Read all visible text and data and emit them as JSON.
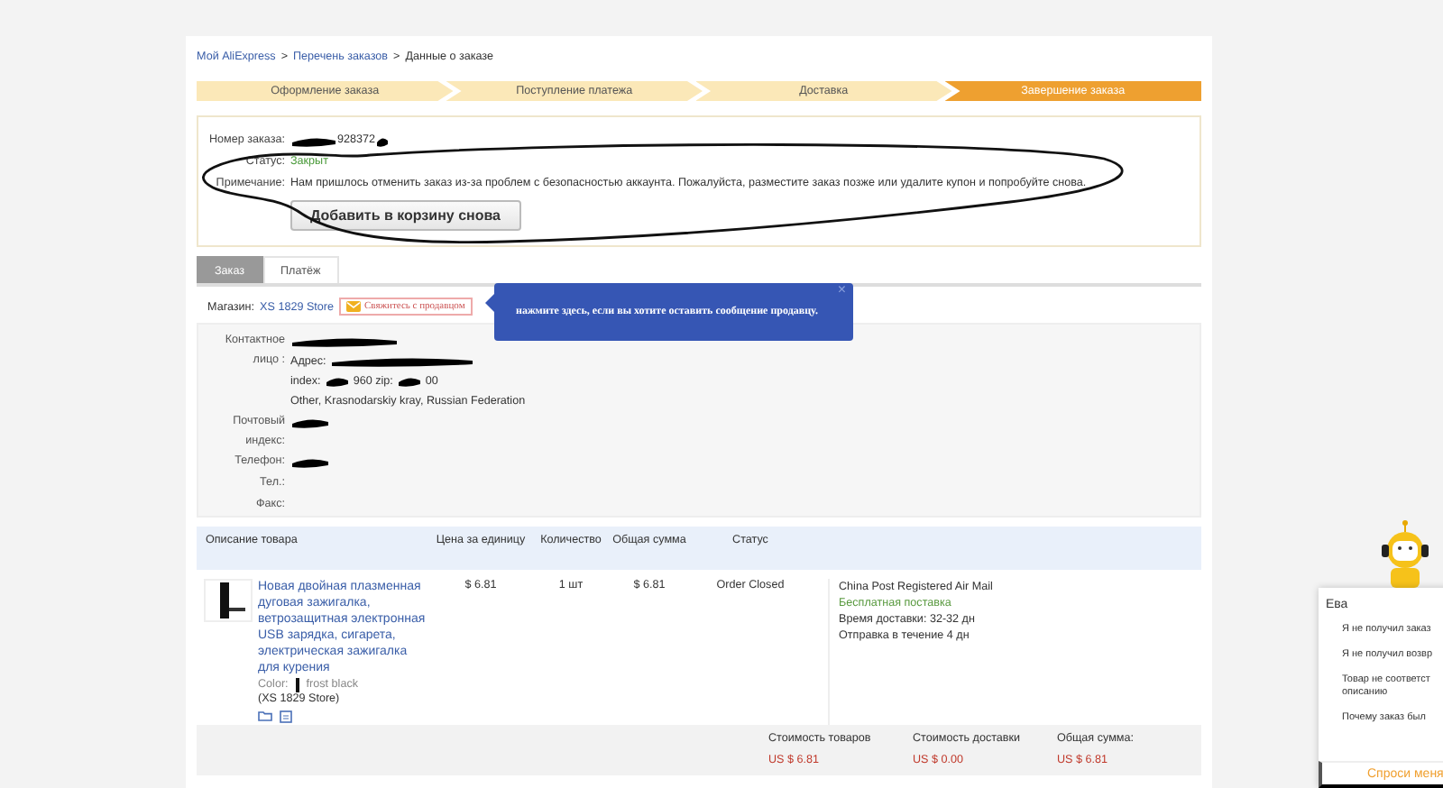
{
  "breadcrumb": [
    {
      "label": "Мой AliExpress",
      "kind": "link"
    },
    {
      "label": ">",
      "kind": "separator"
    },
    {
      "label": "Перечень заказов",
      "kind": "link"
    },
    {
      "label": ">",
      "kind": "separator"
    },
    {
      "label": "Данные о заказе",
      "kind": "current"
    }
  ],
  "steps": [
    {
      "label": "Оформление заказа",
      "selected": false
    },
    {
      "label": "Поступление платежа",
      "selected": false
    },
    {
      "label": "Доставка",
      "selected": false
    },
    {
      "label": "Завершение заказа",
      "selected": true
    }
  ],
  "order_info": {
    "fields": [
      {
        "label": "Номер заказа:",
        "value": "928372",
        "kind": "plain",
        "redacted": true
      },
      {
        "label": "Статус:",
        "value": "Закрыт",
        "kind": "status",
        "redacted": false
      },
      {
        "label": "Примечание:",
        "value": "Нам пришлось отменить заказ из-за проблем с безопасностью аккаунта. Пожалуйста, разместите заказ позже или удалите купон и попробуйте снова.",
        "kind": "plain",
        "redacted": false
      }
    ],
    "button": "Добавить в корзину снова"
  },
  "tabs": [
    {
      "label": "Заказ",
      "selected": true
    },
    {
      "label": "Платёж",
      "selected": false
    }
  ],
  "store": {
    "label": "Магазин:",
    "name": "XS 1829 Store",
    "contact_button": "Свяжитесь с продавцом"
  },
  "tooltip": {
    "text": "нажмите здесь, если вы хотите оставить сообщение продавцу.",
    "close": "×"
  },
  "contact": [
    {
      "label": "Контактное лицо :",
      "lines": [
        [
          {
            "text": "Адрес:",
            "redacted": false
          },
          {
            "redacted": true
          }
        ],
        [
          {
            "text": "index:",
            "redacted": false
          },
          {
            "text": "960 zip:",
            "redacted": true
          },
          {
            "text": "00",
            "redacted": true
          }
        ],
        [
          {
            "text": "Other, Krasnodarskiy kray, Russian Federation",
            "redacted": false
          }
        ]
      ],
      "redacted": true
    },
    {
      "label": "Почтовый индекс:",
      "redacted": true
    },
    {
      "label": "Телефон:",
      "redacted": true
    },
    {
      "label": "Тел.:",
      "redacted": false
    },
    {
      "label": "Факс:",
      "redacted": false
    }
  ],
  "products": {
    "columns": [
      "Описание товара",
      "Цена за единицу",
      "Количество",
      "Общая сумма",
      "Статус"
    ],
    "rows": [
      {
        "title": "Новая двойная плазменная дуговая зажигалка, ветрозащитная электронная USB зарядка, сигарета, электрическая зажигалка для курения",
        "color_label": "Color:",
        "color_value": "frost black",
        "store": "(XS 1829 Store)",
        "price": "$ 6.81",
        "quantity": "1 шт",
        "total": "$ 6.81",
        "status": "Order Closed",
        "shipping": [
          {
            "text": "China Post Registered Air Mail",
            "kind": "plain"
          },
          {
            "text": "Бесплатная поставка",
            "kind": "free"
          },
          {
            "text": "Время доставки: 32-32 дн",
            "kind": "plain"
          },
          {
            "text": "Отправка в течение 4 дн",
            "kind": "plain"
          }
        ]
      }
    ],
    "summary": [
      {
        "label": "Стоимость товаров",
        "value": "US $ 6.81"
      },
      {
        "label": "Стоимость доставки",
        "value": "US $ 0.00"
      },
      {
        "label": "Общая сумма:",
        "value": "US $ 6.81"
      }
    ]
  },
  "chat": {
    "title": "Ева",
    "items": [
      "Я не получил заказ",
      "Я не получил возвр",
      "Товар не соответст описанию",
      "Почему заказ был"
    ],
    "button": "Спроси меня"
  }
}
